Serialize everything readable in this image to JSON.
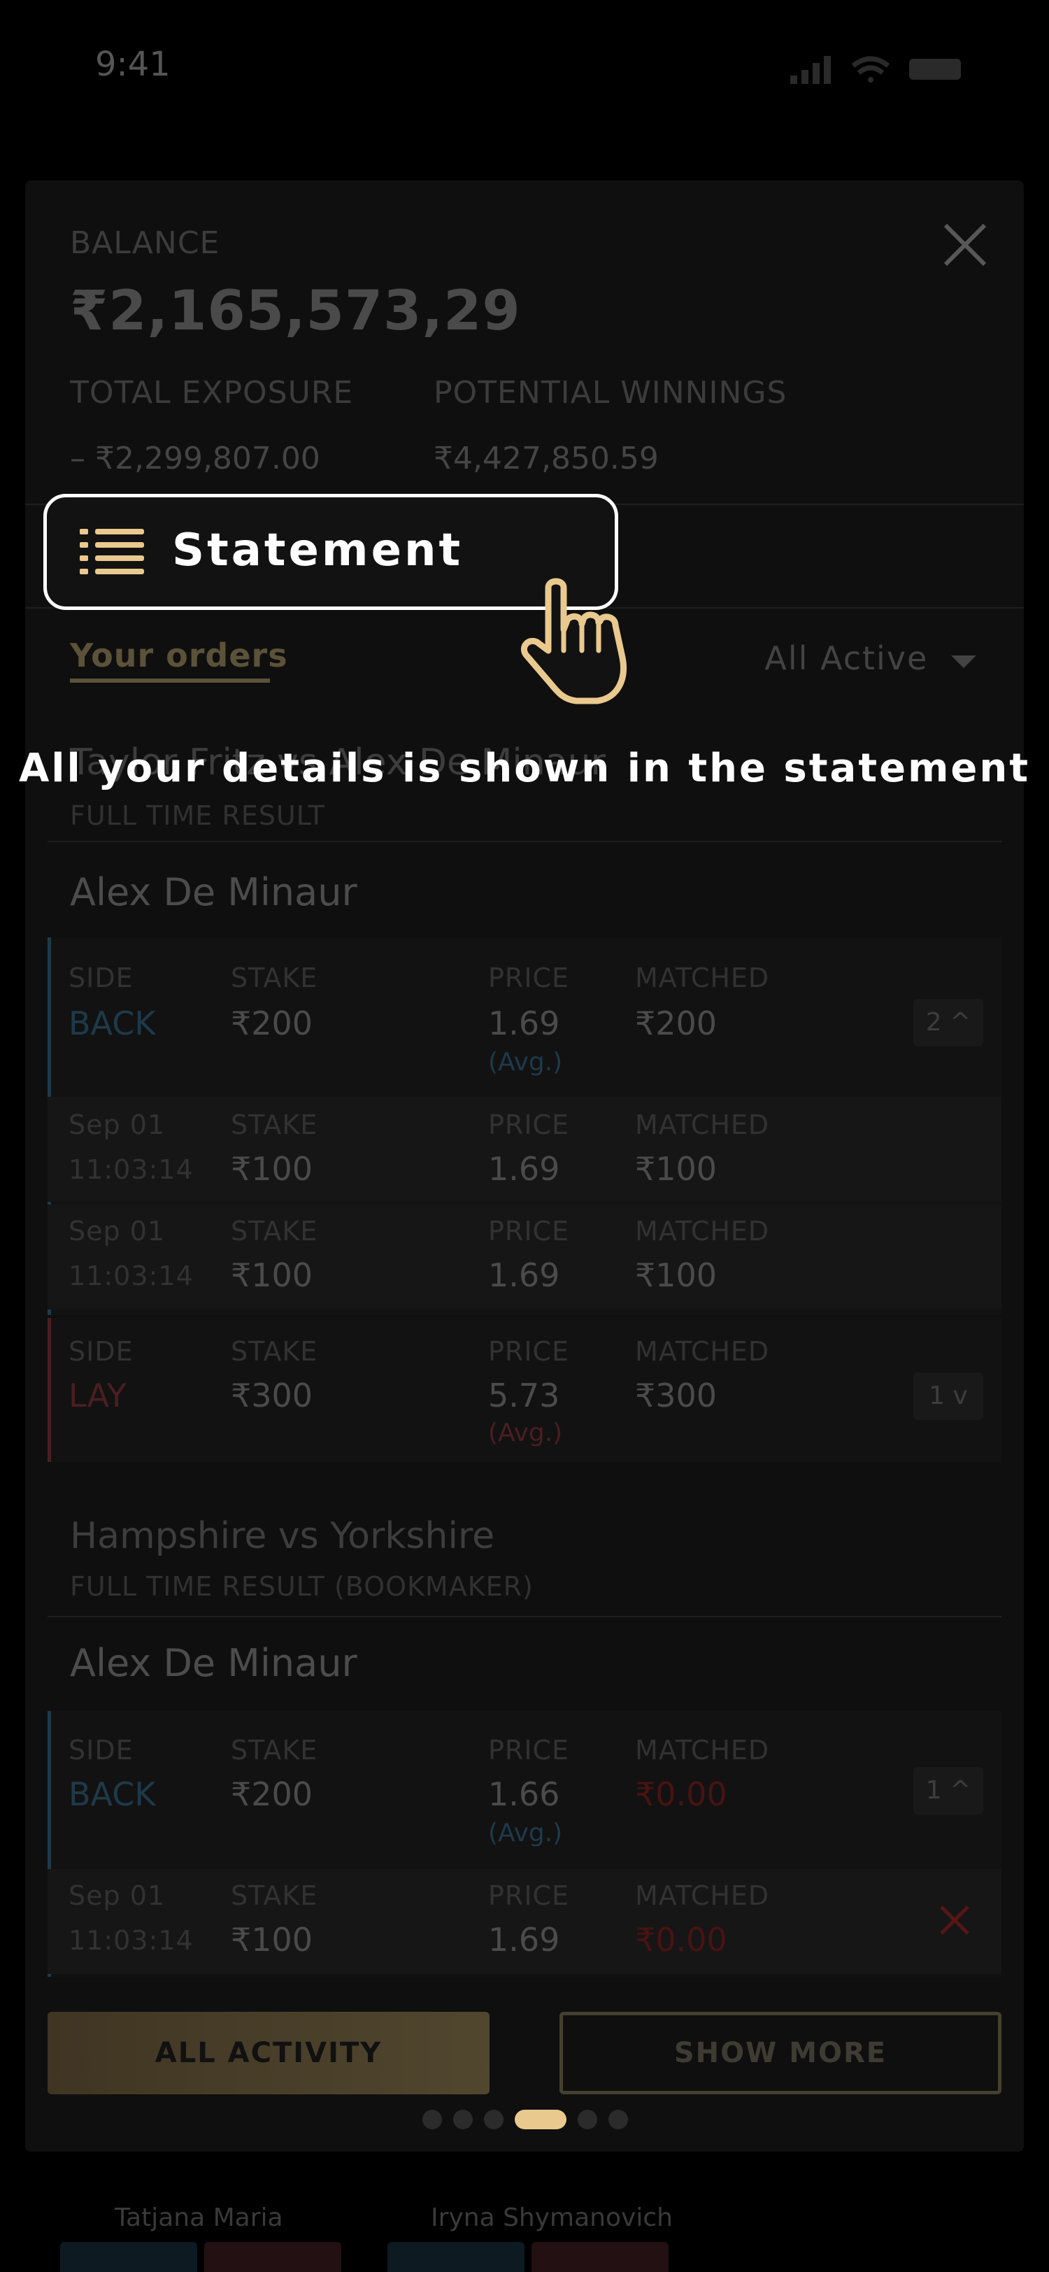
{
  "status": {
    "time": "9:41"
  },
  "balance": {
    "label": "BALANCE",
    "amount": "₹2,165,573,29",
    "exposure_label": "TOTAL EXPOSURE",
    "exposure_value": "– ₹2,299,807.00",
    "winnings_label": "POTENTIAL WINNINGS",
    "winnings_value": "₹4,427,850.59"
  },
  "tutorial": {
    "statement_label": "Statement",
    "message": "All your details is shown in the statement"
  },
  "orders": {
    "tab_label": "Your orders",
    "filter_label": "All Active",
    "event1": {
      "title": "Taylor Fritz vs Alex De Minaur",
      "market": "FULL TIME RESULT",
      "runner": "Alex De Minaur",
      "back": {
        "side_label": "SIDE",
        "side": "BACK",
        "stake_label": "STAKE",
        "stake": "₹200",
        "price_label": "PRICE",
        "price": "1.69",
        "avg": "(Avg.)",
        "matched_label": "MATCHED",
        "matched": "₹200",
        "count": "2"
      },
      "back_sub": [
        {
          "date": "Sep 01",
          "time": "11:03:14",
          "stake_label": "STAKE",
          "stake": "₹100",
          "price_label": "PRICE",
          "price": "1.69",
          "matched_label": "MATCHED",
          "matched": "₹100"
        },
        {
          "date": "Sep 01",
          "time": "11:03:14",
          "stake_label": "STAKE",
          "stake": "₹100",
          "price_label": "PRICE",
          "price": "1.69",
          "matched_label": "MATCHED",
          "matched": "₹100"
        }
      ],
      "lay": {
        "side_label": "SIDE",
        "side": "LAY",
        "stake_label": "STAKE",
        "stake": "₹300",
        "price_label": "PRICE",
        "price": "5.73",
        "avg": "(Avg.)",
        "matched_label": "MATCHED",
        "matched": "₹300",
        "count": "1"
      }
    },
    "event2": {
      "title": "Hampshire vs Yorkshire",
      "market": "FULL TIME RESULT (BOOKMAKER)",
      "runner": "Alex De Minaur",
      "back": {
        "side_label": "SIDE",
        "side": "BACK",
        "stake_label": "STAKE",
        "stake": "₹200",
        "price_label": "PRICE",
        "price": "1.66",
        "avg": "(Avg.)",
        "matched_label": "MATCHED",
        "matched": "₹0.00",
        "count": "1"
      },
      "back_sub": {
        "date": "Sep 01",
        "time": "11:03:14",
        "stake_label": "STAKE",
        "stake": "₹100",
        "price_label": "PRICE",
        "price": "1.69",
        "matched_label": "MATCHED",
        "matched": "₹0.00"
      }
    },
    "buttons": {
      "all_activity": "ALL ACTIVITY",
      "show_more": "SHOW MORE"
    }
  },
  "background": {
    "name1": "Tatjana Maria",
    "name2": "Iryna Shymanovich"
  },
  "colors": {
    "accent": "#e9c98d",
    "back": "#1e3a4a",
    "lay": "#4a1e22",
    "cancel": "#5a1515",
    "zero": "#4a1212"
  },
  "pagination": {
    "total": 6,
    "active": 4
  }
}
